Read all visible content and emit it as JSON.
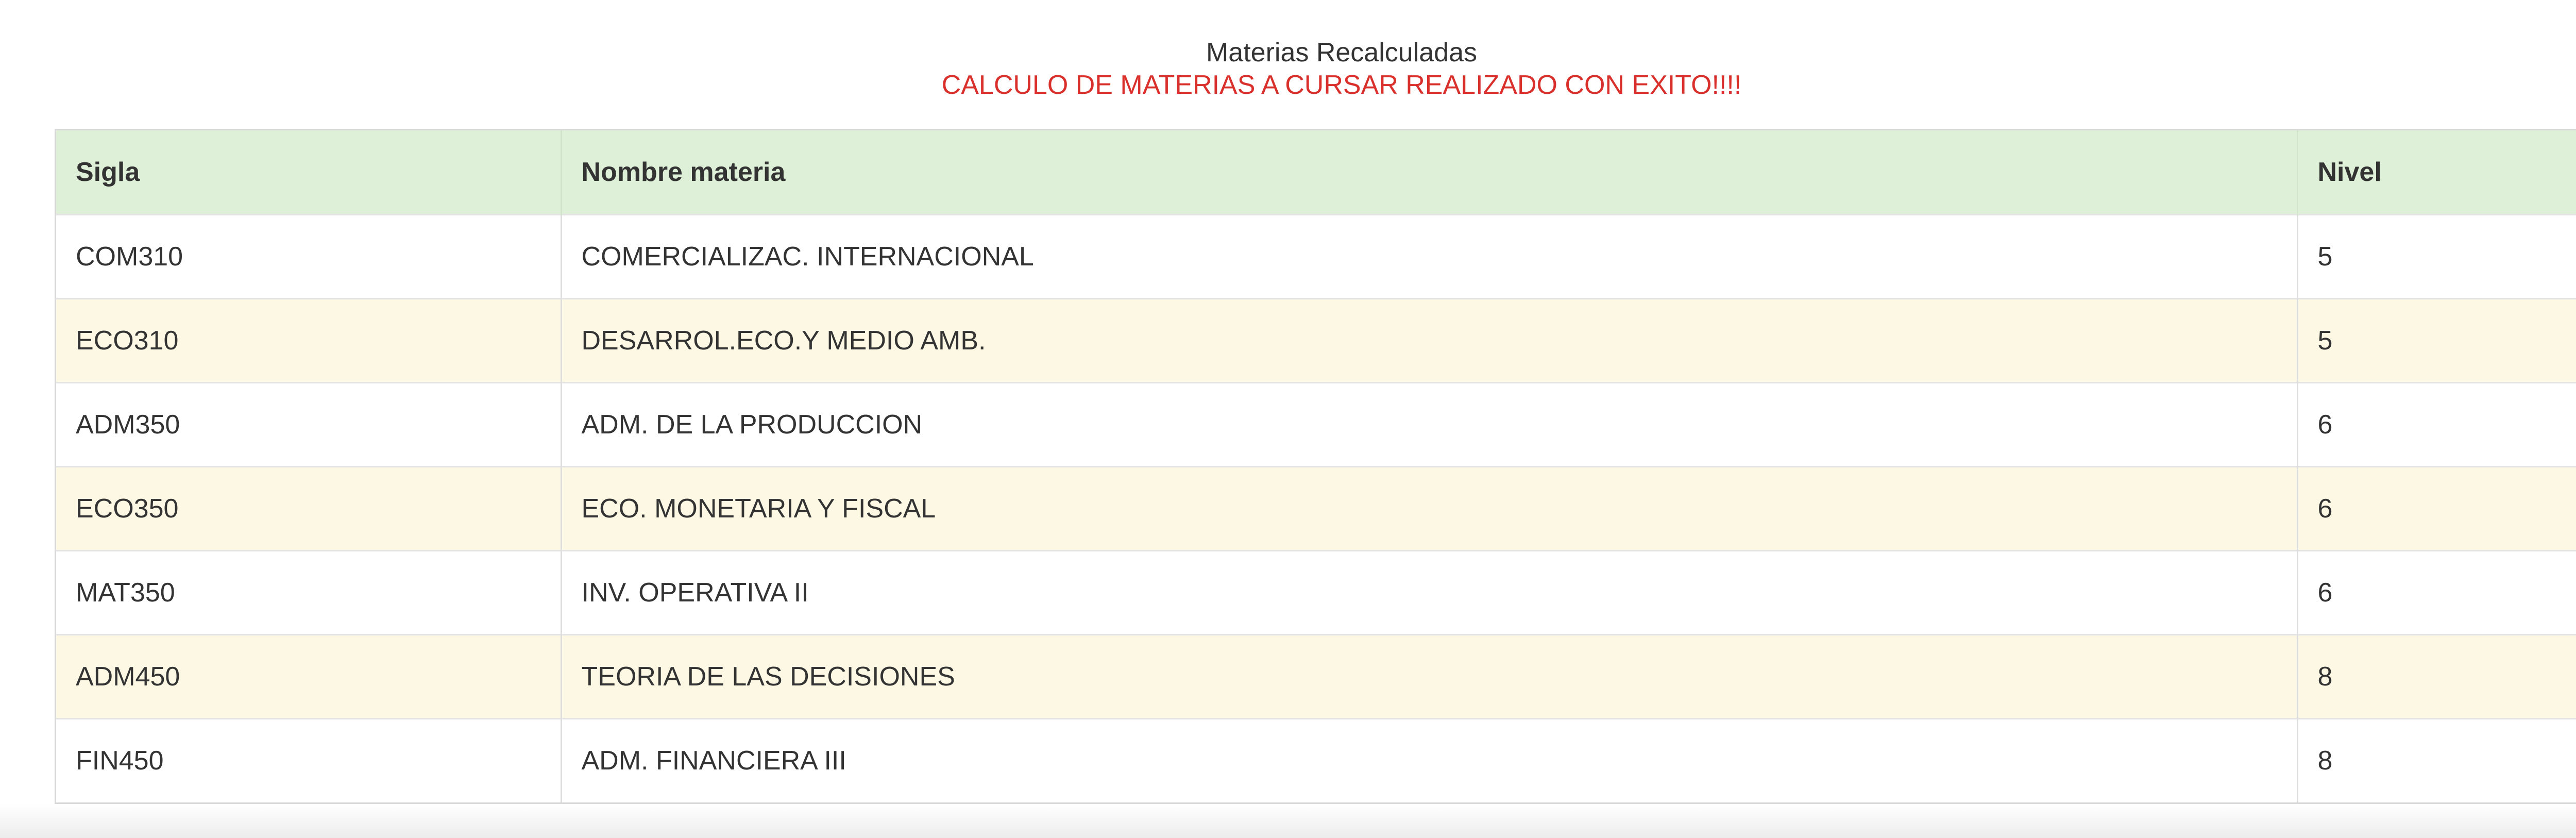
{
  "page": {
    "title": "Materias Recalculadas",
    "status_message": "CALCULO DE MATERIAS A CURSAR REALIZADO CON EXITO!!!!"
  },
  "colors": {
    "header_bg": "#dff0d8",
    "warning_row_bg": "#fcf8e3",
    "status_text": "#d9302c"
  },
  "table": {
    "headers": {
      "sigla": "Sigla",
      "nombre": "Nombre materia",
      "nivel": "Nivel"
    },
    "rows": [
      {
        "sigla": "COM310",
        "nombre": "COMERCIALIZAC. INTERNACIONAL",
        "nivel": "5"
      },
      {
        "sigla": "ECO310",
        "nombre": "DESARROL.ECO.Y MEDIO AMB.",
        "nivel": "5"
      },
      {
        "sigla": "ADM350",
        "nombre": "ADM. DE LA PRODUCCION",
        "nivel": "6"
      },
      {
        "sigla": "ECO350",
        "nombre": "ECO. MONETARIA Y FISCAL",
        "nivel": "6"
      },
      {
        "sigla": "MAT350",
        "nombre": "INV. OPERATIVA II",
        "nivel": "6"
      },
      {
        "sigla": "ADM450",
        "nombre": "TEORIA DE LAS DECISIONES",
        "nivel": "8"
      },
      {
        "sigla": "FIN450",
        "nombre": "ADM. FINANCIERA III",
        "nivel": "8"
      }
    ]
  }
}
